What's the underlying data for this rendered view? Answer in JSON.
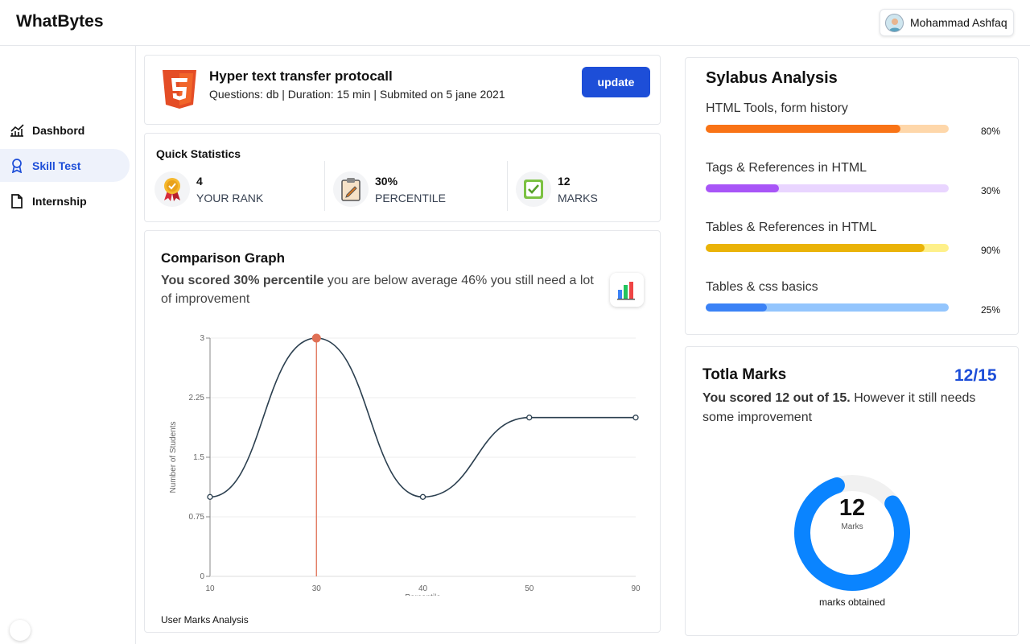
{
  "app": {
    "brand": "WhatBytes"
  },
  "user": {
    "name": "Mohammad Ashfaq"
  },
  "sidebar": {
    "items": [
      {
        "label": "Dashbord",
        "icon": "chart-line-icon",
        "active": false
      },
      {
        "label": "Skill Test",
        "icon": "award-icon",
        "active": true
      },
      {
        "label": "Internship",
        "icon": "file-icon",
        "active": false
      }
    ]
  },
  "test": {
    "title": "Hyper text transfer protocall",
    "meta": "Questions: db | Duration: 15 min | Submited on 5 jane 2021",
    "update_label": "update",
    "badge_icon": "html5-icon"
  },
  "quick_stats": {
    "title": "Quick Statistics",
    "items": [
      {
        "value": "4",
        "label": "YOUR RANK",
        "icon": "trophy-medal-icon"
      },
      {
        "value": "30%",
        "label": "PERCENTILE",
        "icon": "clipboard-icon"
      },
      {
        "value": "12",
        "label": "MARKS",
        "icon": "checkbox-icon"
      }
    ]
  },
  "comparison": {
    "title": "Comparison Graph",
    "desc_bold": "You scored 30% percentile",
    "desc_rest": " you are below average 46% you still need a lot of improvement",
    "icon": "bar-chart-icon",
    "footer": "User Marks Analysis"
  },
  "chart_data": {
    "type": "line",
    "x": [
      10,
      30,
      40,
      50,
      90
    ],
    "y": [
      1,
      3,
      1,
      2,
      2
    ],
    "ylabel": "Number of Students",
    "xlabel": "Percentile",
    "ylim": [
      0,
      3
    ],
    "yticks": [
      "0",
      "0.75",
      "1.5",
      "2.25",
      "3"
    ],
    "highlight_x": 30,
    "colors": {
      "line": "#2b3f4f",
      "highlight": "#e07055"
    },
    "grid": true
  },
  "syllabus": {
    "title": "Sylabus Analysis",
    "items": [
      {
        "label": "HTML Tools, form history",
        "percent": 80,
        "percent_text": "80%",
        "color": "#f97316",
        "track": "#fed7aa"
      },
      {
        "label": "Tags & References in HTML",
        "percent": 30,
        "percent_text": "30%",
        "color": "#a855f7",
        "track": "#e9d5ff"
      },
      {
        "label": "Tables & References in HTML",
        "percent": 90,
        "percent_text": "90%",
        "color": "#eab308",
        "track": "#fef08a"
      },
      {
        "label": "Tables & css basics",
        "percent": 25,
        "percent_text": "25%",
        "color": "#3b82f6",
        "track": "#93c5fd"
      }
    ]
  },
  "total_marks": {
    "title": "Totla Marks",
    "score": "12/15",
    "desc_bold": "You scored 12 out of 15.",
    "desc_rest": " However it still needs some improvement",
    "value": 12,
    "max": 15,
    "value_text": "12",
    "unit": "Marks",
    "caption": "marks obtained",
    "colors": {
      "fill": "#0a84ff",
      "track": "#f1f1f1"
    }
  }
}
